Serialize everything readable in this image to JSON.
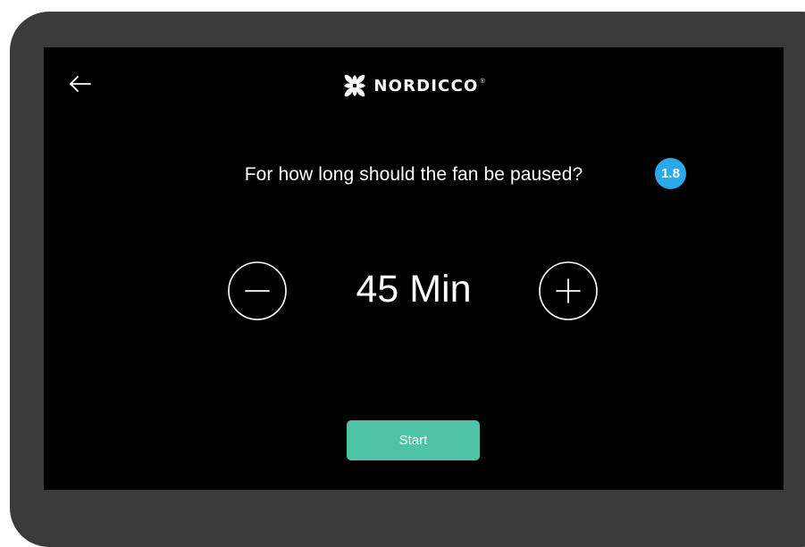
{
  "brand": {
    "name": "NORDICCO",
    "registered_mark": "®"
  },
  "question": "For how long should the fan be paused?",
  "badge": "1.8",
  "duration": {
    "value_text": "45 Min"
  },
  "start_label": "Start",
  "icons": {
    "back": "arrow-left-icon",
    "logo": "fan-logo-icon",
    "decrement": "minus-circle-icon",
    "increment": "plus-circle-icon"
  },
  "colors": {
    "device_frame": "#3b3b3b",
    "screen_background": "#000000",
    "text": "#ffffff",
    "badge": "#29a9e8",
    "start_button": "#4fc3a6"
  }
}
